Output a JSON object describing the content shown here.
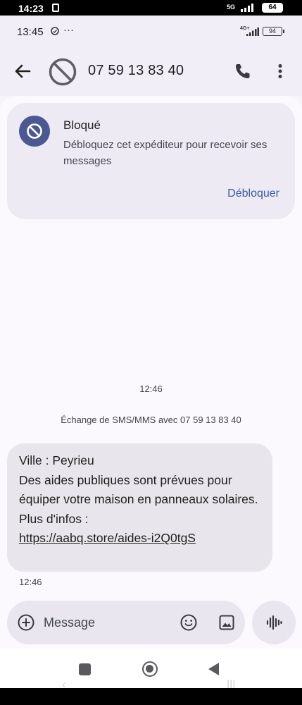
{
  "outer_status": {
    "time": "14:23",
    "network": "5G",
    "battery": "64"
  },
  "status_bar": {
    "time": "13:45",
    "more": "···",
    "network": "4G+",
    "battery": "94"
  },
  "header": {
    "title": "07 59 13 83 40"
  },
  "blocked_card": {
    "title": "Bloqué",
    "description": "Débloquez cet expéditeur pour recevoir ses messages",
    "unblock_label": "Débloquer"
  },
  "conversation": {
    "timestamp": "12:46",
    "exchange_note": "Échange de SMS/MMS avec 07 59 13 83 40",
    "message": {
      "line1": "Ville : Peyrieu",
      "line2": "Des aides publiques sont prévues pour équiper votre maison en panneaux solaires.",
      "line3": "Plus d'infos :",
      "link": "https://aabq.store/aides-i2Q0tgS",
      "time": "12:46"
    }
  },
  "compose": {
    "placeholder": "Message"
  },
  "icons": {
    "back": "arrow-left-icon",
    "avatar": "blocked-icon",
    "call": "phone-icon",
    "more": "more-vert-icon",
    "add": "add-circle-icon",
    "emoji": "emoji-icon",
    "gallery": "gallery-icon",
    "voice": "voice-waveform-icon"
  },
  "colors": {
    "accent": "#4c5892",
    "link": "#3a5aa0",
    "bubble": "#e8e6ec"
  }
}
